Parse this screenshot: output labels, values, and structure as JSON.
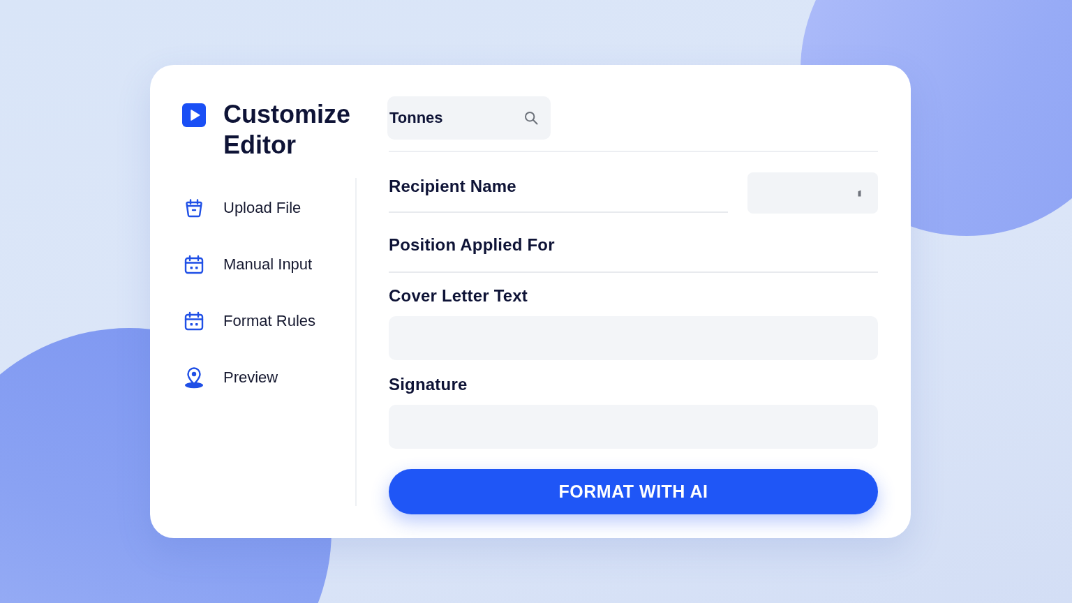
{
  "sidebar": {
    "title": "Customize Editor",
    "items": [
      {
        "label": "Upload File",
        "selected": false
      },
      {
        "label": "Manual Input",
        "selected": false
      },
      {
        "label": "Format Rules",
        "selected": false
      },
      {
        "label": "Preview",
        "selected": false
      }
    ]
  },
  "form": {
    "search": {
      "value": "Tonnes"
    },
    "fields": [
      {
        "kind": "line-with-box",
        "label": "Recipient Name"
      },
      {
        "kind": "line",
        "label": "Position Applied For"
      },
      {
        "kind": "box",
        "label": "Cover Letter Text"
      },
      {
        "kind": "box",
        "label": "Signature"
      }
    ],
    "submit_button": {
      "label": "FORMAT WITH AI"
    }
  }
}
